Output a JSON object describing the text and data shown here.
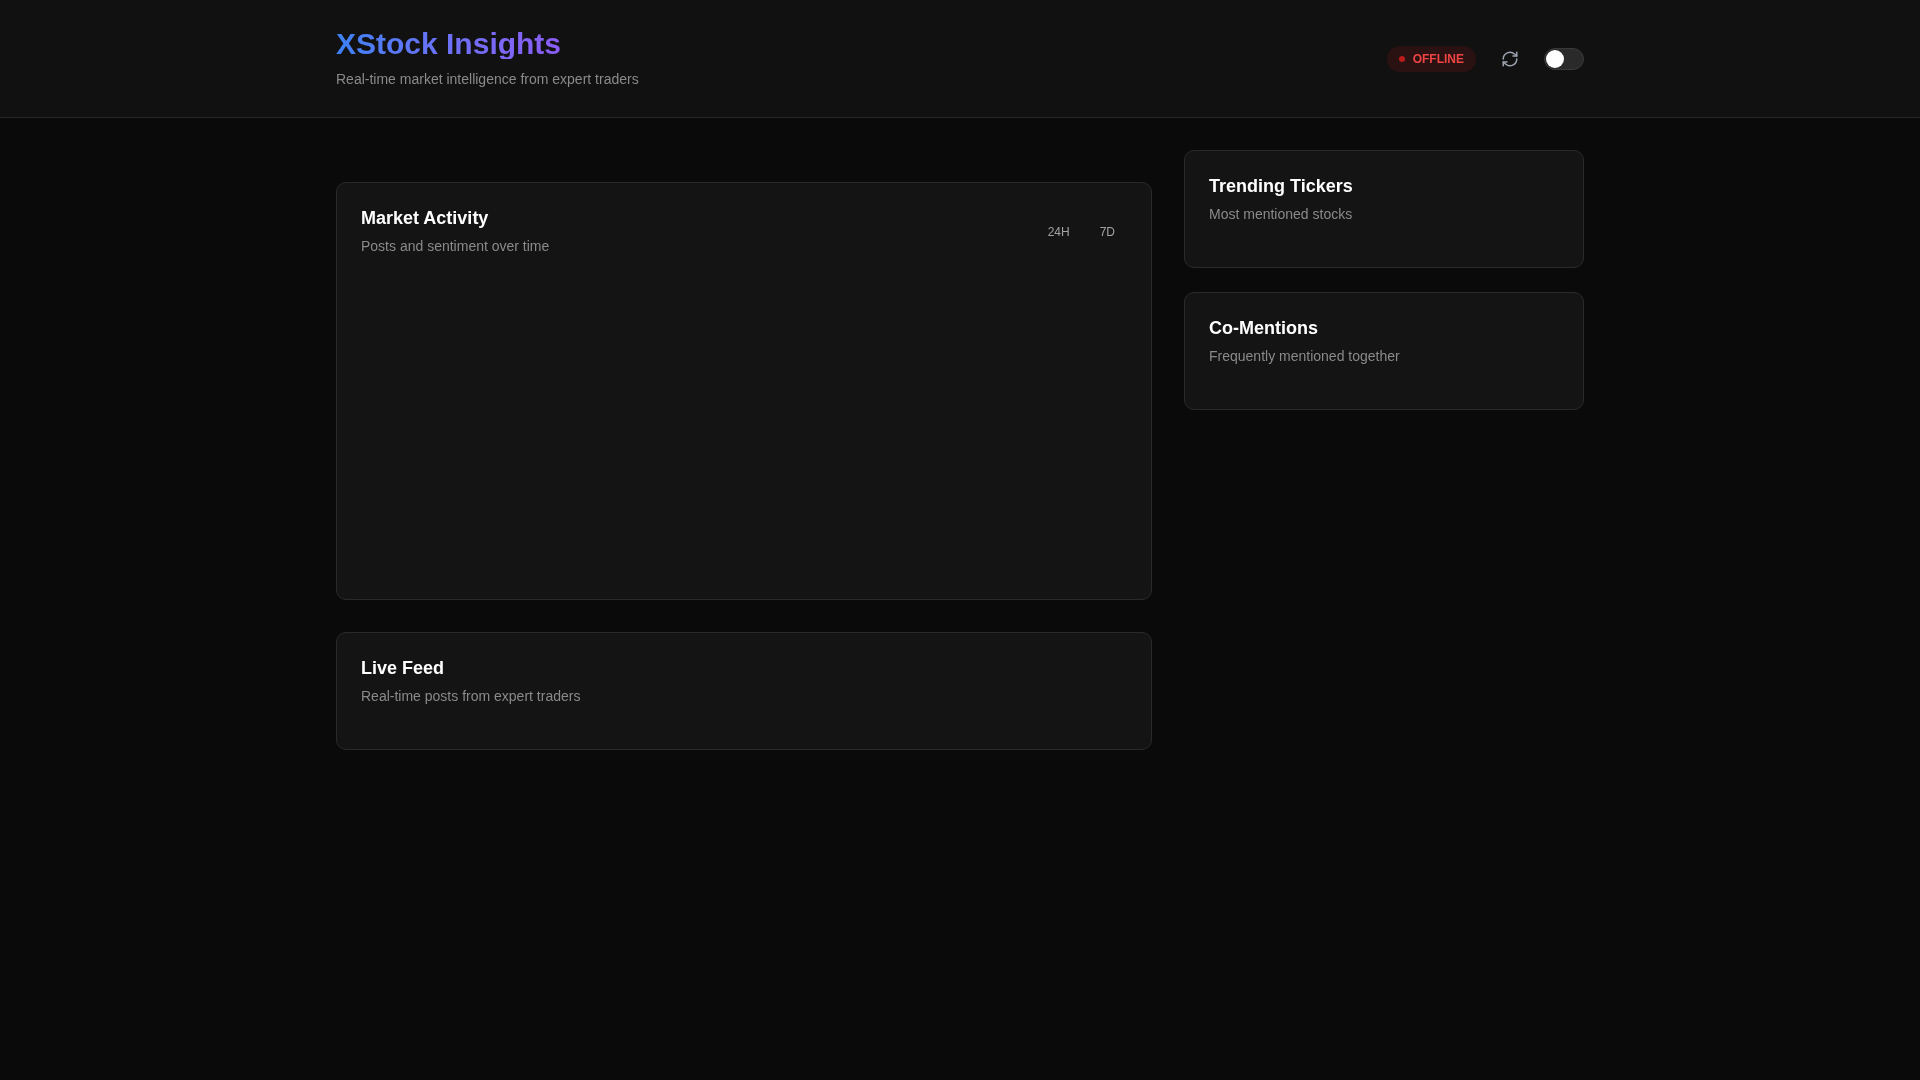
{
  "header": {
    "title": "XStock Insights",
    "subtitle": "Real-time market intelligence from expert traders",
    "status": "OFFLINE",
    "toggle": {
      "on": false
    }
  },
  "market_activity": {
    "title": "Market Activity",
    "subtitle": "Posts and sentiment over time",
    "ranges": [
      "24H",
      "7D"
    ]
  },
  "live_feed": {
    "title": "Live Feed",
    "subtitle": "Real-time posts from expert traders"
  },
  "trending_tickers": {
    "title": "Trending Tickers",
    "subtitle": "Most mentioned stocks"
  },
  "co_mentions": {
    "title": "Co-Mentions",
    "subtitle": "Frequently mentioned together"
  }
}
